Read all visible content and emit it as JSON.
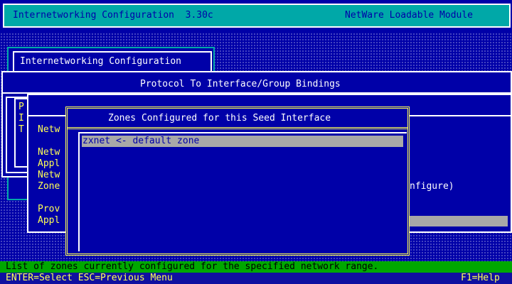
{
  "header": {
    "app_title": "Internetworking Configuration  3.30c",
    "module_label": "NetWare Loadable Module"
  },
  "main_menu": {
    "title": "Internetworking Configuration"
  },
  "bindings_panel": {
    "title": "Protocol To Interface/Group Bindings"
  },
  "left_column_letters": [
    "P",
    "I",
    "T"
  ],
  "background_menu": {
    "items": [
      "Netw",
      "Netw",
      "Appl",
      "Netw",
      "Zone",
      "Prov",
      "Appl"
    ],
    "right_fragment": "nfigure)"
  },
  "zones_dialog": {
    "title": "Zones Configured for this Seed Interface",
    "items": [
      {
        "label": "zxnet <- default zone",
        "selected": true
      }
    ]
  },
  "status": {
    "help_line": "List of zones currently configured for the specified network range.",
    "keys_left": "ENTER=Select ESC=Previous Menu",
    "keys_right": "F1=Help"
  },
  "colors": {
    "background": "#0000a8",
    "header": "#00a8a8",
    "highlight_text": "#ffff55",
    "selection": "#a8a8a8",
    "status_bar": "#00a800"
  }
}
